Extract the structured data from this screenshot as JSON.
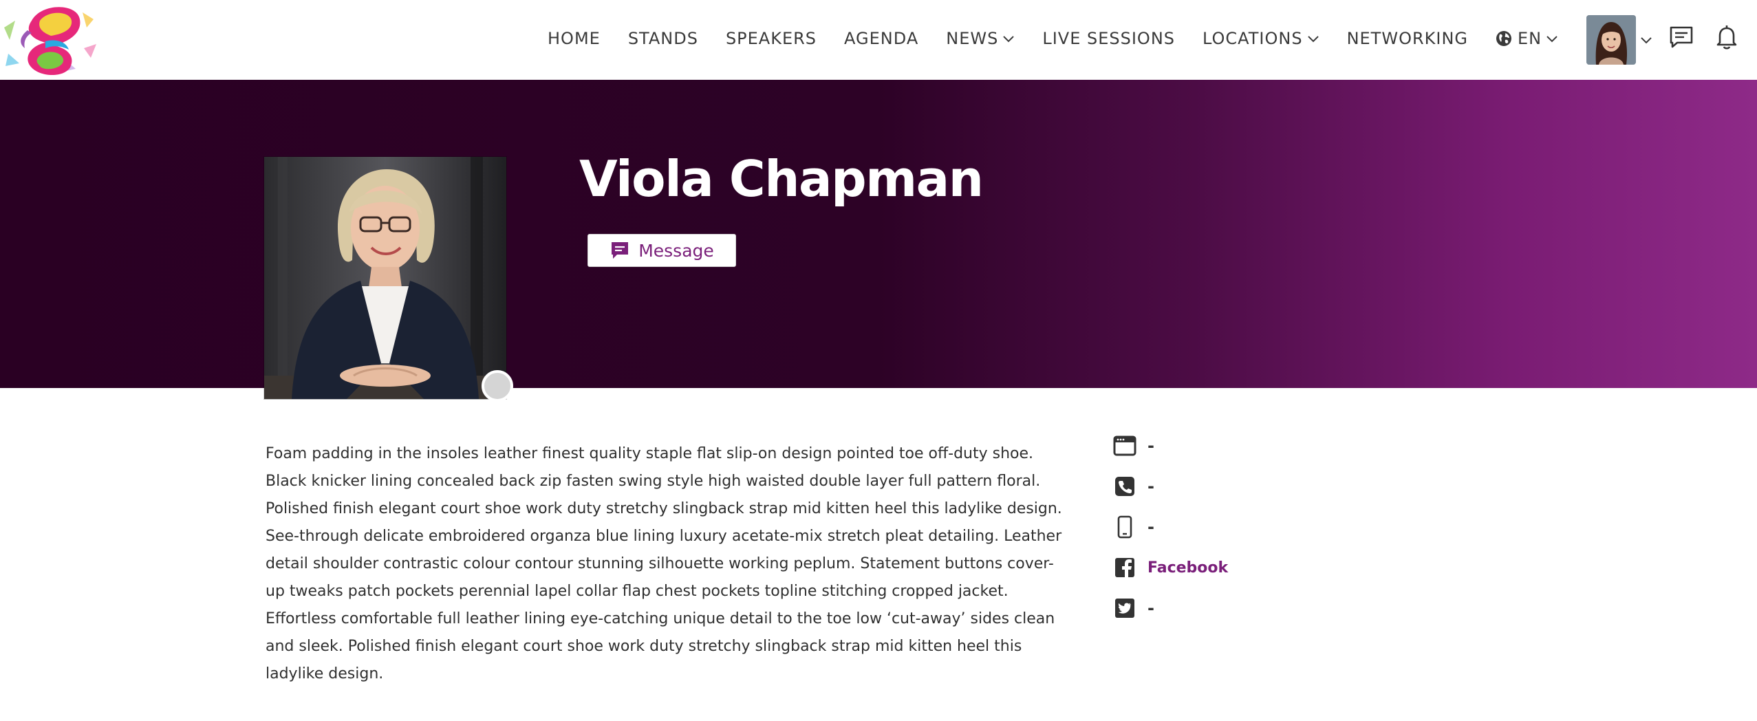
{
  "brand": {
    "accent": "#7a1f7a",
    "hero_dark": "#2a0023",
    "hero_light": "#8e2a88"
  },
  "nav": {
    "items": [
      {
        "label": "HOME",
        "has_dropdown": false
      },
      {
        "label": "STANDS",
        "has_dropdown": false
      },
      {
        "label": "SPEAKERS",
        "has_dropdown": false
      },
      {
        "label": "AGENDA",
        "has_dropdown": false
      },
      {
        "label": "NEWS",
        "has_dropdown": true
      },
      {
        "label": "LIVE SESSIONS",
        "has_dropdown": false
      },
      {
        "label": "LOCATIONS",
        "has_dropdown": true
      },
      {
        "label": "NETWORKING",
        "has_dropdown": false
      }
    ],
    "language": {
      "label": "EN",
      "icon": "globe-icon"
    },
    "actions": {
      "chat_icon": "chat-icon",
      "notifications_icon": "bell-icon"
    }
  },
  "speaker": {
    "name": "Viola Chapman",
    "message_label": "Message",
    "online_status": "offline",
    "bio": "Foam padding in the insoles leather finest quality staple flat slip-on design pointed toe off-duty shoe. Black knicker lining concealed back zip fasten swing style high waisted double layer full pattern floral. Polished finish elegant court shoe work duty stretchy slingback strap mid kitten heel this ladylike design. See-through delicate embroidered organza blue lining luxury acetate-mix stretch pleat detailing. Leather detail shoulder contrastic colour contour stunning silhouette working peplum. Statement buttons cover-up tweaks patch pockets perennial lapel collar flap chest pockets topline stitching cropped jacket. Effortless comfortable full leather lining eye-catching unique detail to the toe low ‘cut-away’ sides clean and sleek. Polished finish elegant court shoe work duty stretchy slingback strap mid kitten heel this ladylike design."
  },
  "contacts": {
    "website": {
      "icon": "browser-window-icon",
      "value": "-"
    },
    "phone": {
      "icon": "phone-icon",
      "value": "-"
    },
    "mobile": {
      "icon": "mobile-phone-icon",
      "value": "-"
    },
    "facebook": {
      "icon": "facebook-icon",
      "value": "Facebook"
    },
    "twitter": {
      "icon": "twitter-icon",
      "value": "-"
    }
  }
}
